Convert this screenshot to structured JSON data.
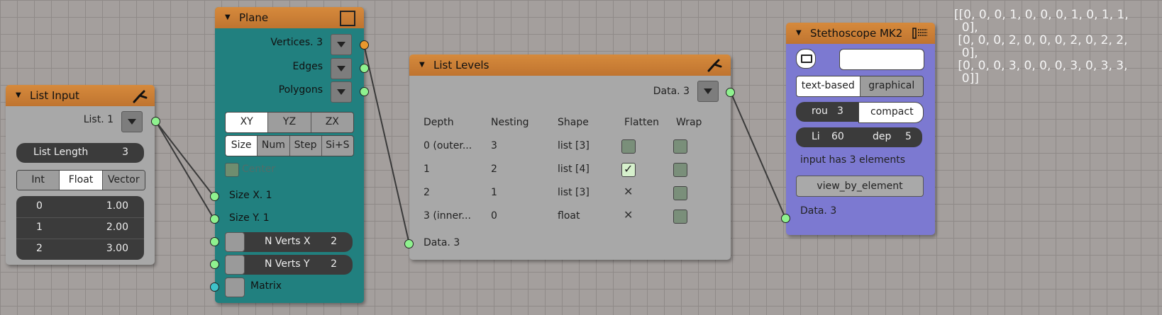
{
  "colors": {
    "header": "#c97e36",
    "plane_body": "#21807f",
    "stethoscope_body": "#7c79d1",
    "socket_green": "#8ff28f",
    "socket_orange": "#e8982e",
    "socket_cyan": "#3fc2c9"
  },
  "list_input": {
    "title": "List Input",
    "output_label": "List. 1",
    "list_length_label": "List Length",
    "list_length_value": "3",
    "modes": [
      "Int",
      "Float",
      "Vector"
    ],
    "selected_mode": "Float",
    "rows": [
      {
        "index": "0",
        "value": "1.00"
      },
      {
        "index": "1",
        "value": "2.00"
      },
      {
        "index": "2",
        "value": "3.00"
      }
    ]
  },
  "plane": {
    "title": "Plane",
    "outputs": [
      "Vertices. 3",
      "Edges",
      "Polygons"
    ],
    "planes": [
      "XY",
      "YZ",
      "ZX"
    ],
    "selected_plane": "XY",
    "dims": [
      "Size",
      "Num",
      "Step",
      "Si+S"
    ],
    "selected_dim": "Size",
    "center_label": "Center",
    "inputs": [
      "Size X. 1",
      "Size Y. 1"
    ],
    "nverts_x_label": "N Verts X",
    "nverts_x_value": "2",
    "nverts_y_label": "N Verts Y",
    "nverts_y_value": "2",
    "matrix_label": "Matrix"
  },
  "list_levels": {
    "title": "List Levels",
    "output_label": "Data. 3",
    "columns": [
      "Depth",
      "Nesting",
      "Shape",
      "Flatten",
      "Wrap"
    ],
    "rows": [
      {
        "depth": "0 (outer...",
        "nesting": "3",
        "shape": "list [3]"
      },
      {
        "depth": "1",
        "nesting": "2",
        "shape": "list [4]"
      },
      {
        "depth": "2",
        "nesting": "1",
        "shape": "list [3]"
      },
      {
        "depth": "3 (inner...",
        "nesting": "0",
        "shape": "float"
      }
    ],
    "input_label": "Data. 3"
  },
  "stethoscope": {
    "title": "Stethoscope MK2",
    "text_based_label": "text-based",
    "graphical_label": "graphical",
    "rou_label": "rou",
    "rou_value": "3",
    "compact_label": "compact",
    "li_label": "Li",
    "li_value": "60",
    "dep_label": "dep",
    "dep_value": "5",
    "info": "input has 3 elements",
    "view_button": "view_by_element",
    "input_label": "Data. 3"
  },
  "output_text": [
    "[[0, 0, 0, 1, 0, 0, 0, 1, 0, 1, 1,",
    "  0],",
    " [0, 0, 0, 2, 0, 0, 0, 2, 0, 2, 2,",
    "  0],",
    " [0, 0, 0, 3, 0, 0, 0, 3, 0, 3, 3,",
    "  0]]"
  ]
}
